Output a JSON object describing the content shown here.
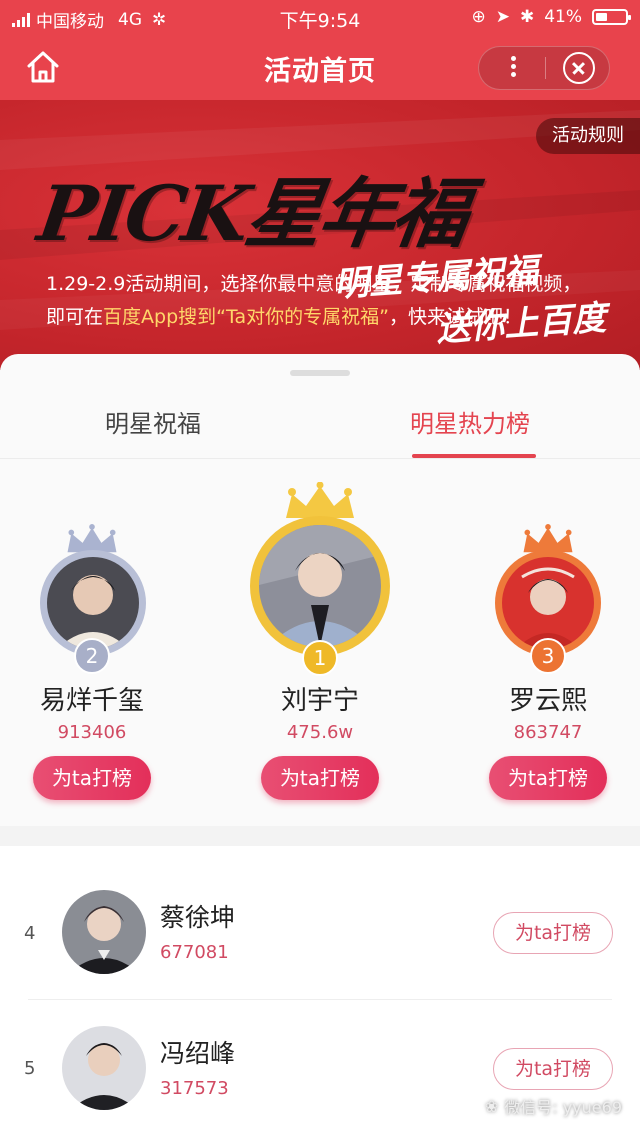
{
  "status_bar": {
    "carrier": "中国移动",
    "network": "4G",
    "time": "下午9:54",
    "battery": "41%",
    "battery_level": 0.41
  },
  "nav": {
    "title": "活动首页",
    "icons": [
      "home-icon",
      "more-icon",
      "close-icon"
    ]
  },
  "banner": {
    "rules_label": "活动规则",
    "headline": "PICK星年福",
    "subline_1": "明星专属祝福",
    "subline_2": "送你上百度",
    "description_1": "1.29-2.9活动期间，选择你最中意的明星，定制专属祝福视频，",
    "description_2_prefix": "即可在",
    "description_2_highlight": "百度App搜到“Ta对你的专属祝福”",
    "description_2_suffix": "，快来试试吧！",
    "highlight_color": "#ffd76a"
  },
  "tabs": [
    {
      "label": "明星祝福",
      "active": false
    },
    {
      "label": "明星热力榜",
      "active": true
    }
  ],
  "podium": [
    {
      "rank": "2",
      "name": "易烊千玺",
      "score": "913406",
      "button": "为ta打榜",
      "ring_color": "#b8bfd6"
    },
    {
      "rank": "1",
      "name": "刘宇宁",
      "score": "475.6w",
      "button": "为ta打榜",
      "ring_color": "#f1c23b"
    },
    {
      "rank": "3",
      "name": "罗云熙",
      "score": "863747",
      "button": "为ta打榜",
      "ring_color": "#ee7a3a"
    }
  ],
  "list": [
    {
      "rank": "4",
      "name": "蔡徐坤",
      "score": "677081",
      "button": "为ta打榜"
    },
    {
      "rank": "5",
      "name": "冯绍峰",
      "score": "317573",
      "button": "为ta打榜"
    }
  ],
  "watermark": "微信号: yyue69",
  "colors": {
    "brand_red": "#e8434c",
    "accent_pink": "#e4444f",
    "score_pink": "#d14a62"
  }
}
